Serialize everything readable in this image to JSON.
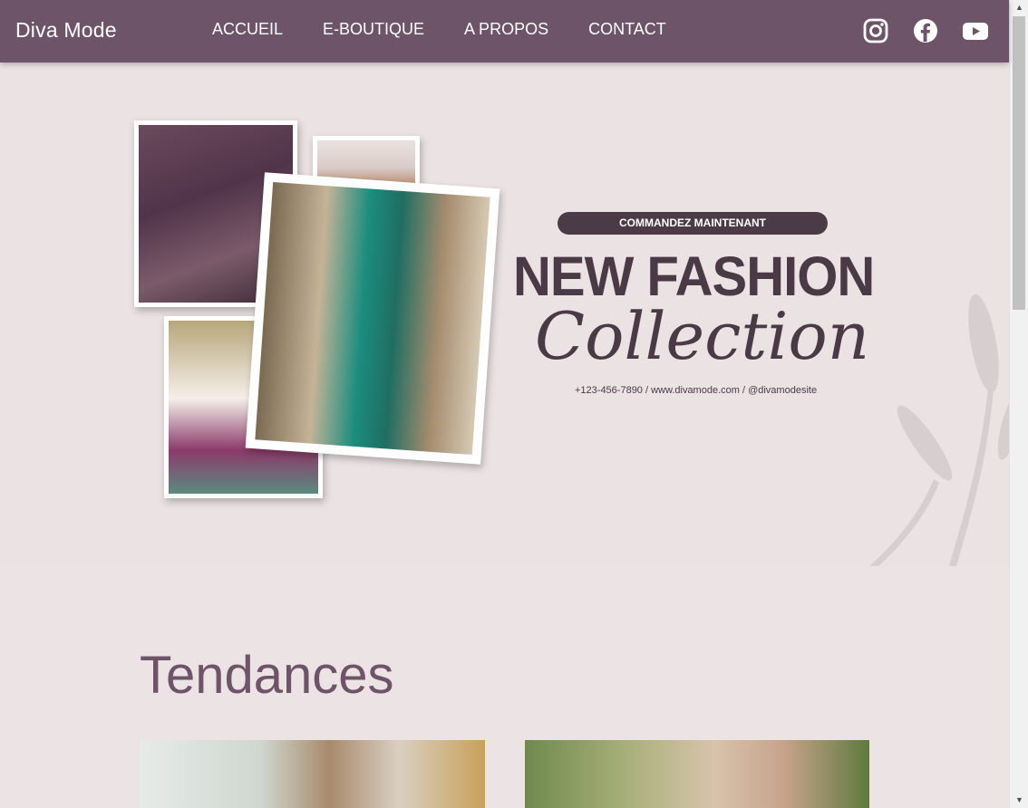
{
  "brand": "Diva Mode",
  "nav": {
    "links": [
      "ACCUEIL",
      "E-BOUTIQUE",
      "A PROPOS",
      "CONTACT"
    ],
    "socials": [
      "instagram-icon",
      "facebook-icon",
      "youtube-icon"
    ]
  },
  "hero": {
    "cta": "COMMANDEZ MAINTENANT",
    "title": "NEW FASHION",
    "script": "Collection",
    "contact": "+123-456-7890 / www.divamode.com / @divamodesite"
  },
  "section": {
    "title": "Tendances"
  },
  "colors": {
    "nav_bg": "#6d5468",
    "page_bg": "#ece3e4",
    "hero_text": "#4a3a45"
  }
}
